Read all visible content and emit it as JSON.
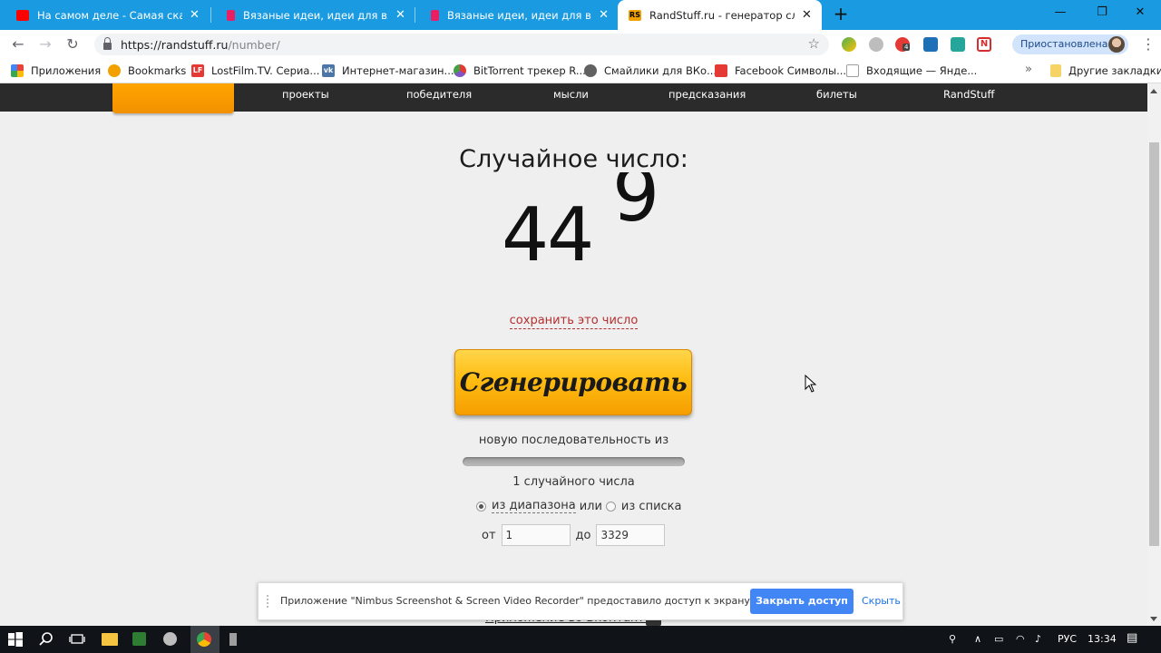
{
  "browser": {
    "tabs": [
      {
        "title": "На самом деле - Самая скандальная",
        "fav_color": "#ff0000"
      },
      {
        "title": "Вязаные идеи, идеи для вязания",
        "fav_color": "#e91e63"
      },
      {
        "title": "Вязаные идеи, идеи для вязания",
        "fav_color": "#e91e63"
      },
      {
        "title": "RandStuff.ru - генератор случайных",
        "fav_color": "#f2a100",
        "fav_text": "RS"
      }
    ],
    "new_tab": "+",
    "url_host": "https://randstuff.ru",
    "url_path": "/number/",
    "profile_status": "Приостановлена",
    "bookmarks": [
      {
        "label": "Приложения",
        "color": "#4285f4"
      },
      {
        "label": "Bookmarks",
        "color": "#f2a100"
      },
      {
        "label": "LostFilm.TV. Сериа...",
        "color": "#e53935",
        "icon_text": "LF"
      },
      {
        "label": "Интернет-магазин...",
        "color": "#4a76a8",
        "icon_text": "vk"
      },
      {
        "label": "BitTorrent трекер R...",
        "color": "#7e57c2"
      },
      {
        "label": "Смайлики для ВКо...",
        "color": "#616161"
      },
      {
        "label": "Facebook Символы...",
        "color": "#e53935"
      },
      {
        "label": "Входящие — Янде...",
        "color": "#9e9e9e"
      }
    ],
    "bookmarks_more": "»",
    "other_bookmarks": "Другие закладки",
    "ext_badge": "4"
  },
  "site": {
    "nav": [
      "проекты",
      "победителя",
      "мысли",
      "предсказания",
      "билеты",
      "RandStuff"
    ],
    "heading": "Случайное число:",
    "number_static": "44",
    "number_rolling": "9",
    "save_link": "сохранить это число",
    "generate_button": "Сгенерировать",
    "sequence_text": "новую последовательность из",
    "slider_level": 0.0,
    "count_text": "1 случайного числа",
    "mode_range": "из диапазона",
    "mode_or": "или",
    "mode_list": "из списка",
    "from_label": "от",
    "from_value": "1",
    "to_label": "до",
    "to_value": "3329",
    "vk_app_link": "Приложение во Вконтакте"
  },
  "notification": {
    "text": "Приложение \"Nimbus Screenshot & Screen Video Recorder\" предоставило доступ к экрану и аудио.",
    "stop_button": "Закрыть доступ",
    "hide_button": "Скрыть"
  },
  "taskbar": {
    "language": "РУС",
    "time": "13:34"
  },
  "colors": {
    "tab_strip": "#1a9ae0",
    "nav_bar": "#2b2b2b",
    "accent_orange": "#ffbd12",
    "link_red": "#b3302f",
    "notify_button": "#4285f4"
  }
}
